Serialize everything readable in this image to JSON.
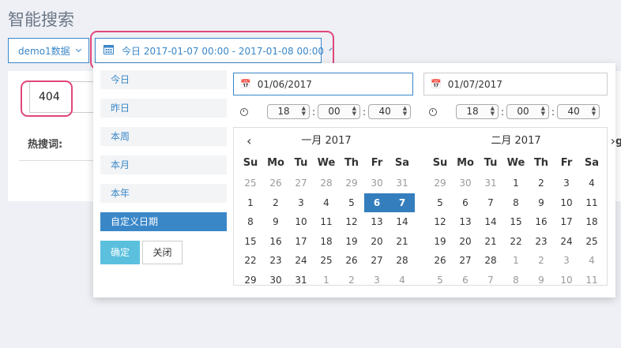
{
  "title": "智能搜索",
  "datasource_button": "demo1数据",
  "date_range_button": "今日 2017-01-07 00:00 - 2017-01-08 00:00",
  "search": {
    "value": "404"
  },
  "hot_label": "热搜词:",
  "hot_label_tail": "g",
  "ranges": [
    "今日",
    "昨日",
    "本周",
    "本月",
    "本年",
    "自定义日期"
  ],
  "active_range": "自定义日期",
  "confirm": "确定",
  "close": "关闭",
  "start": {
    "date": "01/06/2017",
    "hour": "18",
    "minute": "00",
    "second": "40"
  },
  "end": {
    "date": "01/07/2017",
    "hour": "18",
    "minute": "00",
    "second": "40"
  },
  "calendars": [
    {
      "month": "一月 2017",
      "weekdays": [
        "Su",
        "Mo",
        "Tu",
        "We",
        "Th",
        "Fr",
        "Sa"
      ],
      "weeks": [
        [
          "25",
          "26",
          "27",
          "28",
          "29",
          "30",
          "31"
        ],
        [
          "1",
          "2",
          "3",
          "4",
          "5",
          "6",
          "7"
        ],
        [
          "8",
          "9",
          "10",
          "11",
          "12",
          "13",
          "14"
        ],
        [
          "15",
          "16",
          "17",
          "18",
          "19",
          "20",
          "21"
        ],
        [
          "22",
          "23",
          "24",
          "25",
          "26",
          "27",
          "28"
        ],
        [
          "29",
          "30",
          "31",
          "1",
          "2",
          "3",
          "4"
        ]
      ],
      "off": [
        "0-0",
        "0-1",
        "0-2",
        "0-3",
        "0-4",
        "0-5",
        "0-6",
        "5-3",
        "5-4",
        "5-5",
        "5-6"
      ],
      "selected": [
        "1-5",
        "1-6"
      ]
    },
    {
      "month": "二月 2017",
      "weekdays": [
        "Su",
        "Mo",
        "Tu",
        "We",
        "Th",
        "Fr",
        "Sa"
      ],
      "weeks": [
        [
          "29",
          "30",
          "31",
          "1",
          "2",
          "3",
          "4"
        ],
        [
          "5",
          "6",
          "7",
          "8",
          "9",
          "10",
          "11"
        ],
        [
          "12",
          "13",
          "14",
          "15",
          "16",
          "17",
          "18"
        ],
        [
          "19",
          "20",
          "21",
          "22",
          "23",
          "24",
          "25"
        ],
        [
          "26",
          "27",
          "28",
          "1",
          "2",
          "3",
          "4"
        ],
        [
          "5",
          "6",
          "7",
          "8",
          "9",
          "10",
          "11"
        ]
      ],
      "off": [
        "0-0",
        "0-1",
        "0-2",
        "4-3",
        "4-4",
        "4-5",
        "4-6",
        "5-0",
        "5-1",
        "5-2",
        "5-3",
        "5-4",
        "5-5",
        "5-6"
      ],
      "selected": []
    }
  ],
  "colors": {
    "accent": "#3a87c8",
    "highlight": "#e0467a",
    "selected": "#357ebd",
    "ok": "#5bc0de"
  }
}
